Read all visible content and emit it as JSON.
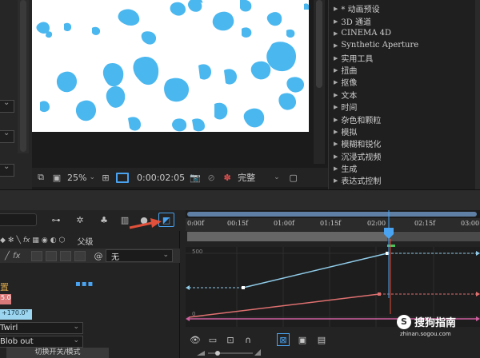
{
  "viewer": {
    "zoom": "25%",
    "timecode": "0:00:02:05",
    "resolution": "完整"
  },
  "effects": {
    "items": [
      {
        "label": "* 动画预设"
      },
      {
        "label": "3D 通道"
      },
      {
        "label": "CINEMA 4D"
      },
      {
        "label": "Synthetic Aperture"
      },
      {
        "label": "实用工具"
      },
      {
        "label": "扭曲"
      },
      {
        "label": "抠像"
      },
      {
        "label": "文本"
      },
      {
        "label": "时间"
      },
      {
        "label": "杂色和颗粒"
      },
      {
        "label": "模拟"
      },
      {
        "label": "模糊和锐化"
      },
      {
        "label": "沉浸式视频"
      },
      {
        "label": "生成"
      },
      {
        "label": "表达式控制"
      }
    ]
  },
  "timeline": {
    "ruler_labels": [
      "0:00f",
      "00:15f",
      "01:00f",
      "01:15f",
      "02:00",
      "02:15f",
      "03:00"
    ],
    "parent_header": "父级",
    "parent_value": "无",
    "property_label": "置",
    "value_pink": "5.0",
    "value_blue": "+170.0°",
    "dropdown1": "Twirl",
    "dropdown2": "Blob out",
    "toggle_label": "切换开关/模式"
  },
  "graph": {
    "y_top": "500",
    "y_bottom": "0"
  },
  "watermark": {
    "brand": "搜狗指南",
    "url": "zhinan.sogou.com"
  },
  "colors": {
    "accent": "#4aa3f0",
    "blob": "#4ab7ef",
    "curve_blue": "#8fcbe8",
    "curve_pink": "#e07070",
    "curve_magenta": "#d060a0",
    "arrow": "#e0503a"
  }
}
